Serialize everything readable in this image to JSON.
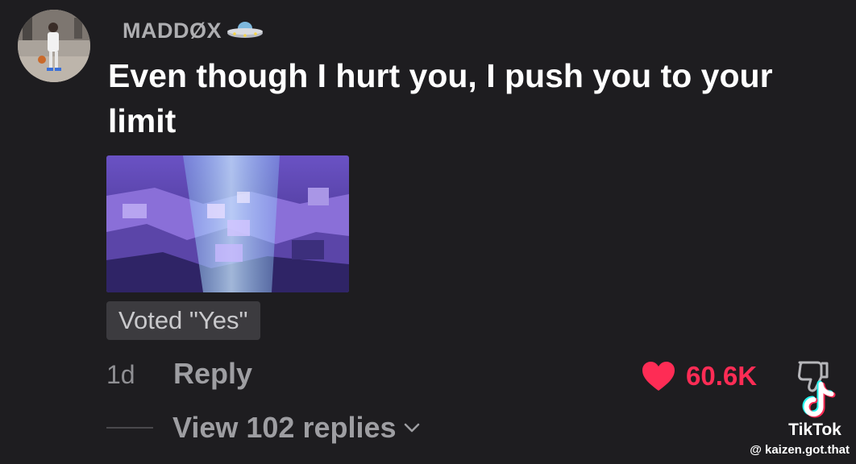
{
  "comment": {
    "username": "MADDØX",
    "username_emoji": "flying-saucer-icon",
    "text": "Even though I hurt you, I push you to your limit",
    "vote_badge": "Voted \"Yes\"",
    "timestamp": "1d",
    "reply_label": "Reply",
    "likes": "60.6K",
    "liked": true,
    "view_replies_label": "View 102 replies"
  },
  "watermark": {
    "brand": "TikTok",
    "handle": "@ kaizen.got.that"
  },
  "colors": {
    "background": "#1e1d20",
    "like_red": "#fe2c55",
    "muted_text": "#9e9ea2",
    "badge_bg": "#3c3b3f"
  }
}
